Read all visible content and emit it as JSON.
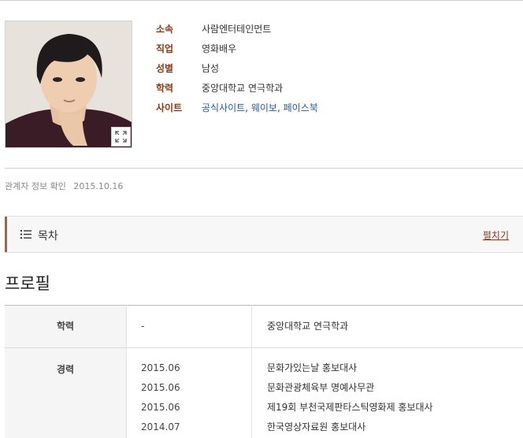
{
  "info": {
    "rows": [
      {
        "key": "소속",
        "value": "사람엔터테인먼트"
      },
      {
        "key": "직업",
        "value": "영화배우"
      },
      {
        "key": "성별",
        "value": "남성"
      },
      {
        "key": "학력",
        "value": "중앙대학교 연극학과"
      }
    ],
    "site_key": "사이트",
    "site_links": [
      "공식사이트",
      "웨이보",
      "페이스북"
    ]
  },
  "confirm": {
    "label": "관계자 정보 확인",
    "date": "2015.10.16"
  },
  "toc": {
    "title": "목차",
    "expand": "펼치기"
  },
  "section": {
    "title": "프로필"
  },
  "profile": {
    "education": {
      "head": "학력",
      "year": "-",
      "desc": "중앙대학교 연극학과"
    },
    "career": {
      "head": "경력",
      "items": [
        {
          "year": "2015.06",
          "desc": "문화가있는날 홍보대사"
        },
        {
          "year": "2015.06",
          "desc": "문화관광체육부 명예사무관"
        },
        {
          "year": "2015.06",
          "desc": "제19회 부천국제판타스틱영화제 홍보대사"
        },
        {
          "year": "2014.07",
          "desc": "한국영상자료원 홍보대사"
        }
      ]
    }
  },
  "colors": {
    "label": "#8a3a1a",
    "link": "#2a5a8a",
    "toc_bar": "#8a6a5a"
  },
  "icons": {
    "expand": "expand-icon",
    "toc": "list-icon"
  }
}
